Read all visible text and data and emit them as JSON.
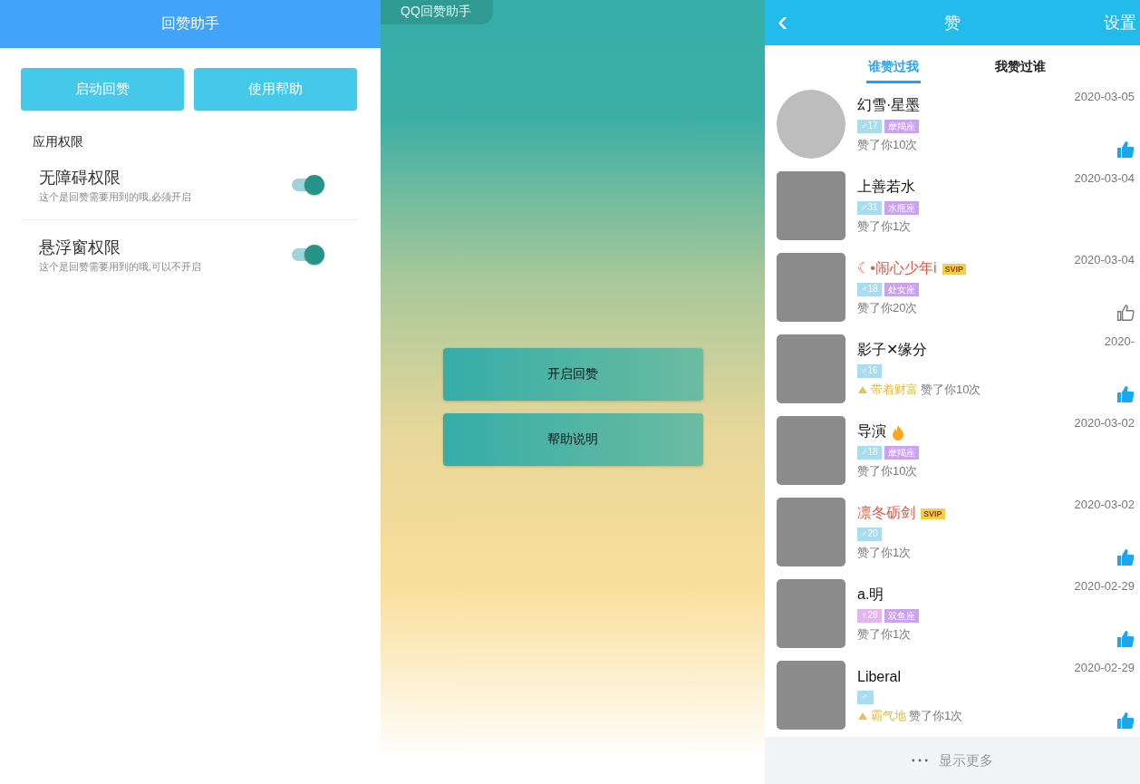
{
  "left_panel": {
    "title": "回赞助手",
    "buttons": [
      "启动回赞",
      "使用帮助"
    ],
    "section_title": "应用权限",
    "permissions": [
      {
        "title": "无障碍权限",
        "description": "这个是回赞需要用到的哦,必须开启",
        "on": true
      },
      {
        "title": "悬浮窗权限",
        "description": "这个是回赞需要用到的哦,可以不开启",
        "on": true
      }
    ]
  },
  "middle_panel": {
    "badge": "QQ回赞助手",
    "buttons": [
      "开启回赞",
      "帮助说明"
    ]
  },
  "right_panel": {
    "back": "‹",
    "title": "赞",
    "settings": "设置",
    "tabs": [
      {
        "label": "谁赞过我",
        "selected": true
      },
      {
        "label": "我赞过谁",
        "selected": false
      }
    ],
    "rows": [
      {
        "name": "幻雪·星墨",
        "vip": false,
        "age": "♂17",
        "constellation": "摩羯座",
        "liked": "赞了你10次",
        "date": "2020-03-05",
        "thumbed": true,
        "round": true
      },
      {
        "name": "上善若水",
        "vip": false,
        "age": "♂31",
        "constellation": "水瓶座",
        "liked": "赞了你1次",
        "date": "2020-03-04",
        "round": false
      },
      {
        "name": "☾•闹心少年i",
        "vip": true,
        "vip_label": "SVIP",
        "age": "♂18",
        "constellation": "处女座",
        "liked": "赞了你20次",
        "date": "2020-03-04",
        "thumbed": false,
        "round": false
      },
      {
        "name": "影子✕缘分",
        "vip": false,
        "age": "♂16",
        "medal": "带着财富",
        "liked": "赞了你10次",
        "date": "2020-",
        "thumbed": true,
        "round": false
      },
      {
        "name": "导演",
        "flame": true,
        "vip": false,
        "age": "♂18",
        "constellation": "摩羯座",
        "liked": "赞了你10次",
        "date": "2020-03-02",
        "round": false
      },
      {
        "name": "凛冬砺剑",
        "vip": true,
        "vip_label": "SVIP",
        "age": "♂20",
        "liked": "赞了你1次",
        "date": "2020-03-02",
        "thumbed": true,
        "round": false
      },
      {
        "name": "a.明",
        "vip": false,
        "age": "♀29",
        "female": true,
        "constellation": "双鱼座",
        "liked": "赞了你1次",
        "date": "2020-02-29",
        "thumbed": true,
        "round": false
      },
      {
        "name": "Liberal",
        "vip": false,
        "age": "♂",
        "medal": "霸气地",
        "liked": "赞了你1次",
        "date": "2020-02-29",
        "thumbed": true,
        "round": false
      }
    ],
    "more": "显示更多"
  }
}
